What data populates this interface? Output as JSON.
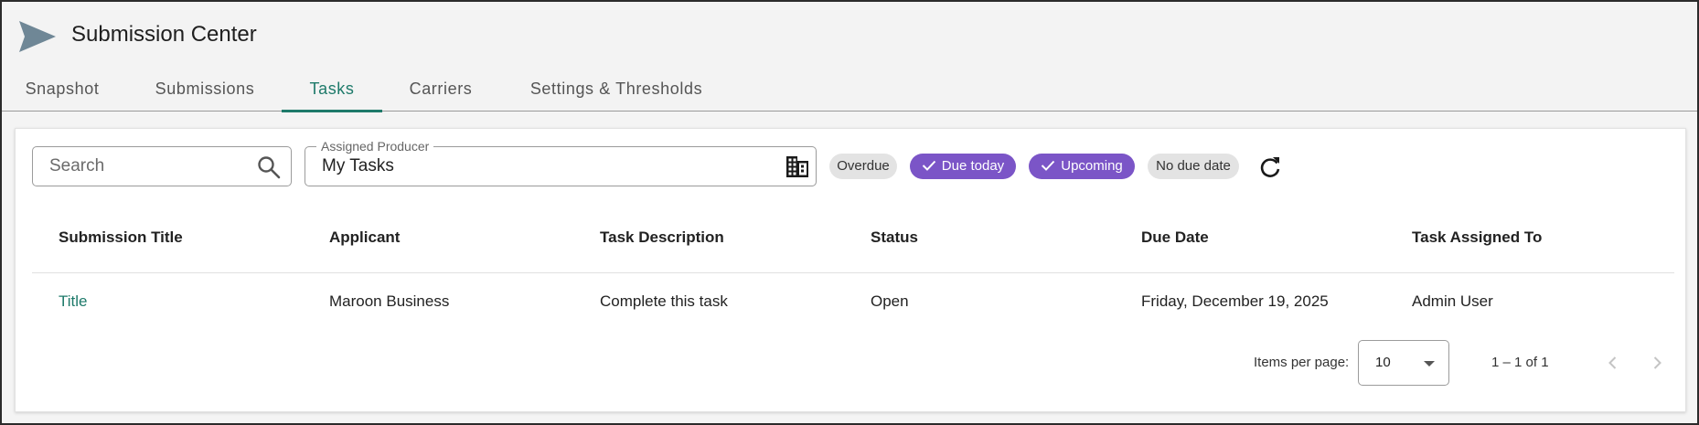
{
  "app": {
    "title": "Submission Center",
    "logo_icon": "paper-plane-icon"
  },
  "tabs": [
    {
      "label": "Snapshot",
      "active": false
    },
    {
      "label": "Submissions",
      "active": false
    },
    {
      "label": "Tasks",
      "active": true
    },
    {
      "label": "Carriers",
      "active": false
    },
    {
      "label": "Settings & Thresholds",
      "active": false
    }
  ],
  "filters": {
    "search": {
      "placeholder": "Search",
      "value": "",
      "icon": "search-icon"
    },
    "producer": {
      "label": "Assigned Producer",
      "value": "My Tasks",
      "icon": "building-icon"
    },
    "chips": [
      {
        "label": "Overdue",
        "selected": false
      },
      {
        "label": "Due today",
        "selected": true
      },
      {
        "label": "Upcoming",
        "selected": true
      },
      {
        "label": "No due date",
        "selected": false
      }
    ],
    "refresh_icon": "refresh-icon"
  },
  "table": {
    "columns": [
      "Submission Title",
      "Applicant",
      "Task Description",
      "Status",
      "Due Date",
      "Task Assigned To"
    ],
    "rows": [
      [
        "Title",
        "Maroon Business",
        "Complete this task",
        "Open",
        "Friday, December 19, 2025",
        "Admin User"
      ]
    ]
  },
  "paginator": {
    "items_per_page_label": "Items per page:",
    "items_per_page_value": "10",
    "range_label": "1 – 1 of 1"
  },
  "colors": {
    "accent": "#1e7a6a",
    "chip_selected": "#7b55c7",
    "chip_unselected": "#e3e3e3"
  }
}
